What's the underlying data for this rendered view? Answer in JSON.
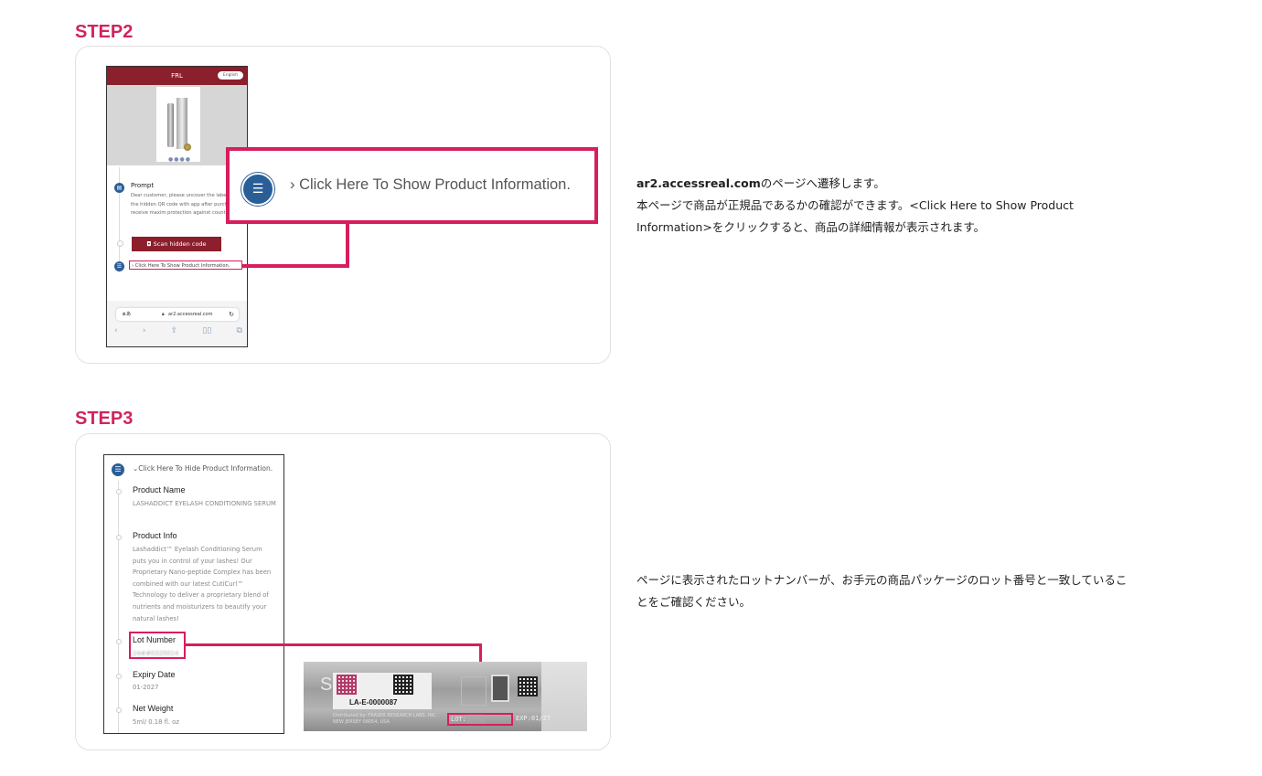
{
  "step2": {
    "title": "STEP2",
    "phone": {
      "header_title": "FRL",
      "lang": "English",
      "prompt_title": "Prompt",
      "prompt_body": "Dear customer, please uncover the label to scan the hidden QR code with app after purchase to receive maxim protection against counterfeits.",
      "scan_button": "Scan hidden code",
      "click_link": "Click Here To Show Product Information.",
      "url_left": "ぁあ",
      "url": "ar2.accessreal.com"
    },
    "callout_text": "Click Here To Show Product Information.",
    "desc_bold": "ar2.accessreal.com",
    "desc_line1": "のページへ遷移します。",
    "desc_line2": "本ページで商品が正規品であるかの確認ができます。<Click Here to Show Product",
    "desc_line3": "Information>をクリックすると、商品の詳細情報が表示されます。"
  },
  "step3": {
    "title": "STEP3",
    "phone": {
      "hide_link": "Click Here To Hide Product Information.",
      "product_name_label": "Product Name",
      "product_name": "LASHADDICT EYELASH CONDITIONING SERUM",
      "product_info_label": "Product Info",
      "product_info": "Lashaddict™ Eyelash Conditioning Serum puts you in control of your lashes! Our Proprietary Nano-peptide Complex has been combined with our latest CutiCurl™ Technology to deliver a proprietary blend of nutrients and moisturizers to beautify your natural lashes!",
      "lot_label": "Lot Number",
      "lot_value": "24##0320014",
      "expiry_label": "Expiry Date",
      "expiry_value": "01-2027",
      "weight_label": "Net Weight",
      "weight_value": "5ml/ 0.18 fl. oz"
    },
    "package": {
      "code": "LA-E-0000087",
      "distributed": "Distributed by: FRASER RESEARCH LABS, INC. NEW JERSEY 08054, USA",
      "lot": "LOT:",
      "exp": "EXP:01/27"
    },
    "desc_line1": "ページに表示されたロットナンバーが、お手元の商品パッケージのロット番号と一致しているこ",
    "desc_line2": "とをご確認ください。"
  }
}
